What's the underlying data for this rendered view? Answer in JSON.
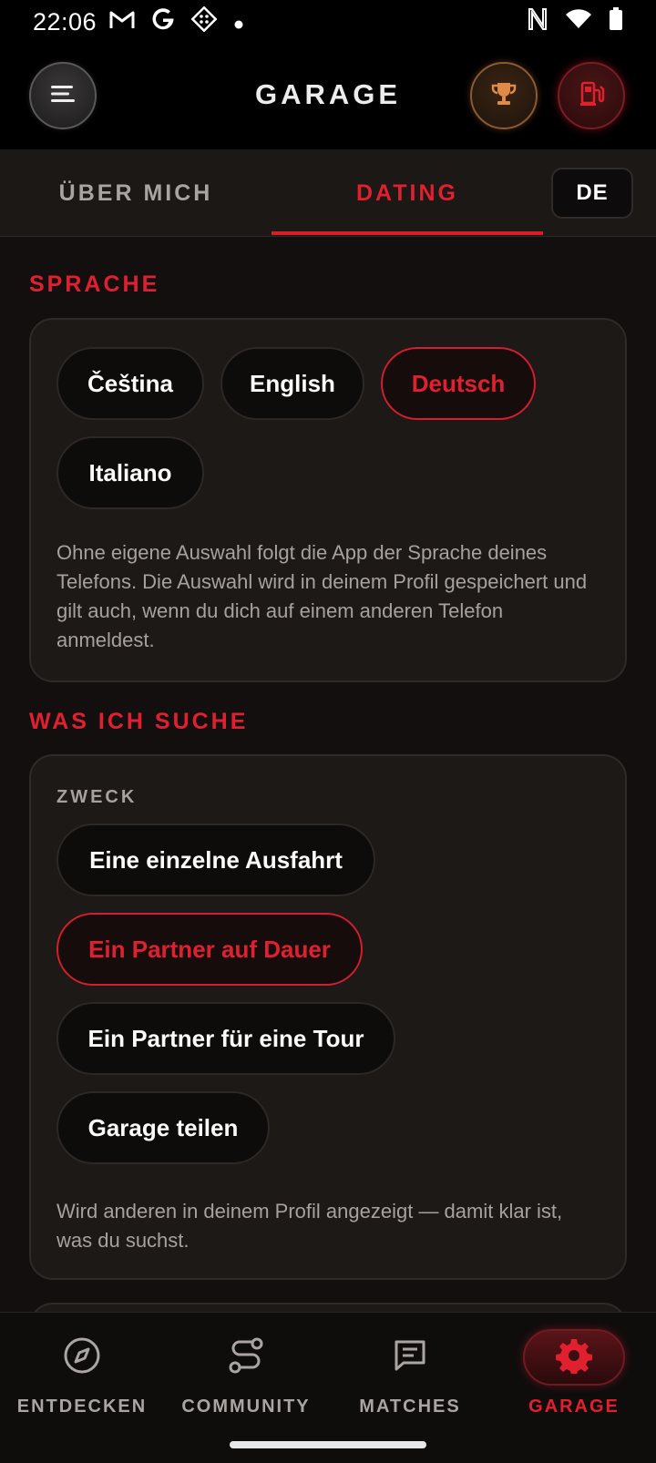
{
  "status_bar": {
    "time": "22:06",
    "icons_left": [
      "gmail-icon",
      "google-icon",
      "game-icon",
      "dot-icon"
    ],
    "icons_right": [
      "nfc-icon",
      "wifi-icon",
      "battery-icon"
    ]
  },
  "header": {
    "title": "GARAGE",
    "buttons": [
      "menu-icon",
      "trophy-icon",
      "fuel-icon"
    ]
  },
  "tabs": {
    "items": [
      {
        "label": "ÜBER MICH",
        "active": false
      },
      {
        "label": "DATING",
        "active": true
      }
    ],
    "language_pill": "DE"
  },
  "sprache": {
    "title": "SPRACHE",
    "options": [
      {
        "label": "Čeština",
        "selected": false
      },
      {
        "label": "English",
        "selected": false
      },
      {
        "label": "Deutsch",
        "selected": true
      },
      {
        "label": "Italiano",
        "selected": false
      }
    ],
    "note": "Ohne eigene Auswahl folgt die App der Sprache deines Telefons. Die Auswahl wird in deinem Profil gespeichert und gilt auch, wenn du dich auf einem anderen Telefon anmeldest."
  },
  "was_ich_suche": {
    "title": "WAS ICH SUCHE",
    "subtitle": "ZWECK",
    "options": [
      {
        "label": "Eine einzelne Ausfahrt",
        "selected": false
      },
      {
        "label": "Ein Partner auf Dauer",
        "selected": true
      },
      {
        "label": "Ein Partner für eine Tour",
        "selected": false
      },
      {
        "label": "Garage teilen",
        "selected": false
      }
    ],
    "note": "Wird anderen in deinem Profil angezeigt — damit klar ist, was du suchst."
  },
  "bottom_nav": {
    "items": [
      {
        "label": "ENTDECKEN",
        "icon": "compass-icon",
        "active": false
      },
      {
        "label": "COMMUNITY",
        "icon": "route-icon",
        "active": false
      },
      {
        "label": "MATCHES",
        "icon": "chat-icon",
        "active": false
      },
      {
        "label": "GARAGE",
        "icon": "gear-icon",
        "active": true
      }
    ]
  },
  "colors": {
    "accent": "#e0202e",
    "background": "#120f0e",
    "card": "#1c1917",
    "muted_text": "#a7a19e"
  }
}
